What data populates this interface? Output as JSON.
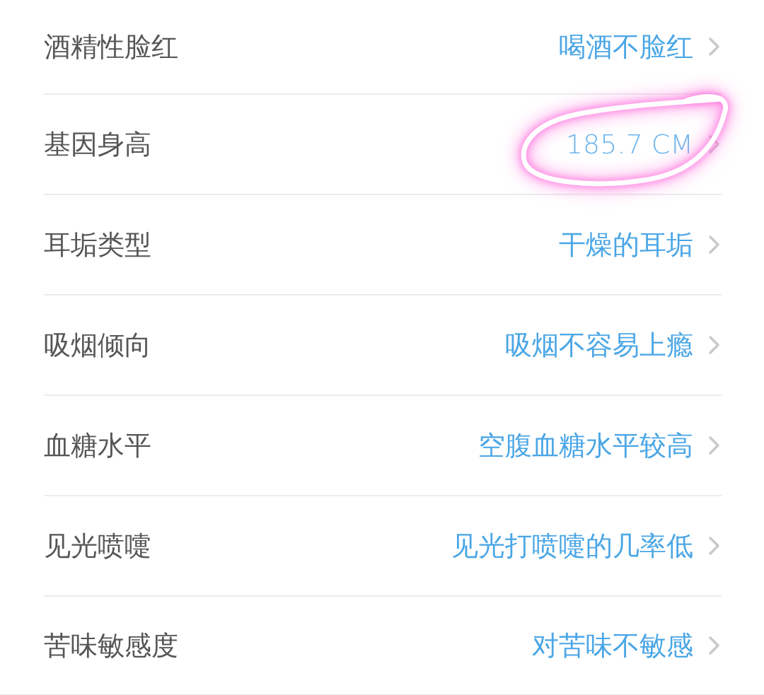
{
  "rows": [
    {
      "label": "酒精性脸红",
      "value": "喝酒不脸红",
      "highlighted": false
    },
    {
      "label": "基因身高",
      "value": "185.7 CM",
      "highlighted": true
    },
    {
      "label": "耳垢类型",
      "value": "干燥的耳垢",
      "highlighted": false
    },
    {
      "label": "吸烟倾向",
      "value": "吸烟不容易上瘾",
      "highlighted": false
    },
    {
      "label": "血糖水平",
      "value": "空腹血糖水平较高",
      "highlighted": false
    },
    {
      "label": "见光喷嚏",
      "value": "见光打喷嚏的几率低",
      "highlighted": false
    },
    {
      "label": "苦味敏感度",
      "value": "对苦味不敏感",
      "highlighted": false
    }
  ]
}
